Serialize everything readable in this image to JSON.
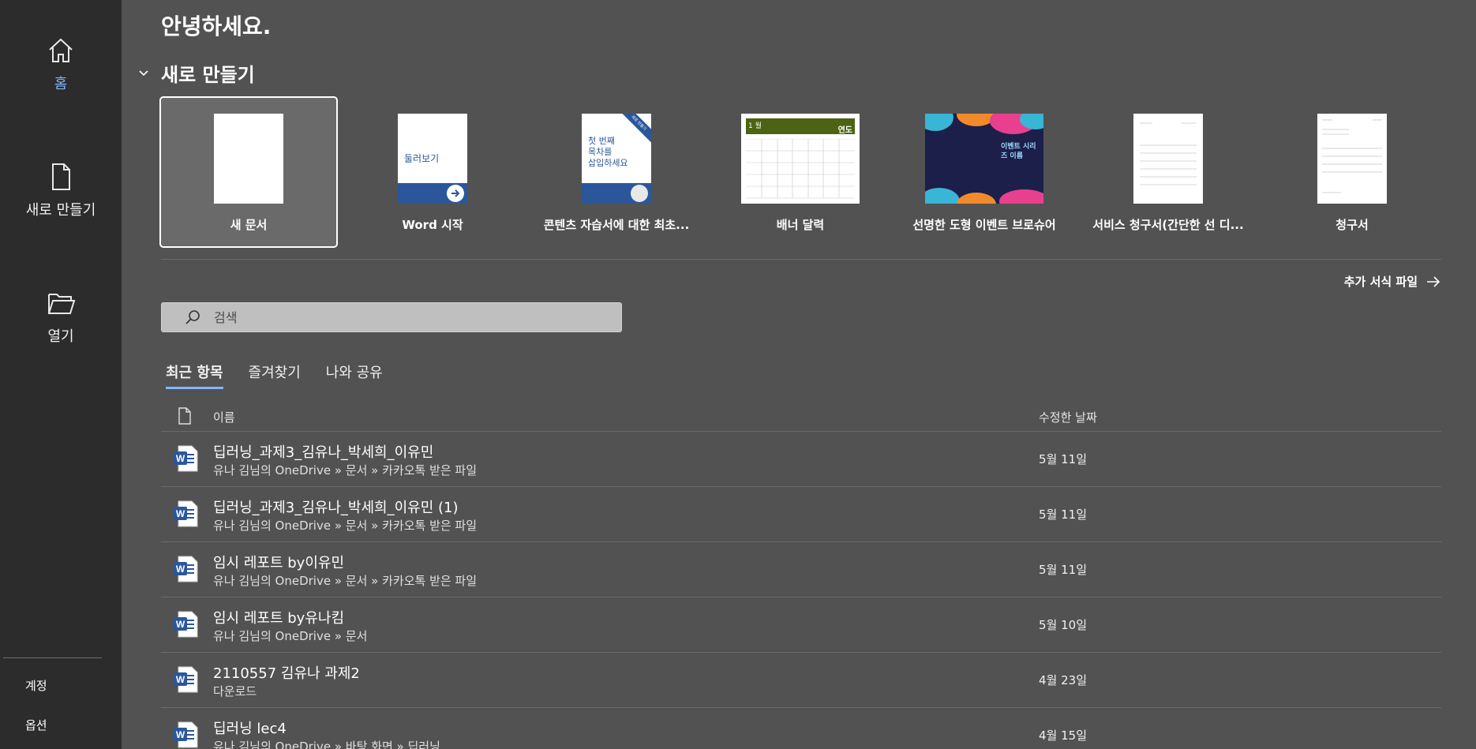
{
  "nav": {
    "home_label": "홈",
    "new_label": "새로 만들기",
    "open_label": "열기",
    "account_label": "계정",
    "options_label": "옵션"
  },
  "main": {
    "greeting": "안녕하세요.",
    "new_section_title": "새로 만들기",
    "templates": [
      {
        "name": "새 문서",
        "icon": "blank-document"
      },
      {
        "name": "Word 시작",
        "icon": "tour-template",
        "thumb_text": "둘러보기"
      },
      {
        "name": "콘텐츠 자습서에 대한 최초...",
        "icon": "toc-template",
        "thumb_text": "첫 번째\n목차를\n삽입하세요",
        "badge": "새로 만들기"
      },
      {
        "name": "배너 달력",
        "icon": "calendar-template",
        "thumb_text_left": "1 월",
        "thumb_text_right": "연도"
      },
      {
        "name": "선명한 도형 이벤트 브로슈어",
        "icon": "brochure-template",
        "thumb_text": "이벤트 시리즈 이름"
      },
      {
        "name": "서비스 청구서(간단한 선 디...",
        "icon": "invoice-template"
      },
      {
        "name": "청구서",
        "icon": "invoice-template-2"
      }
    ],
    "more_templates_label": "추가 서식 파일",
    "search_placeholder": "검색",
    "tabs": [
      "최근 항목",
      "즐겨찾기",
      "나와 공유"
    ],
    "list_headers": {
      "name": "이름",
      "modified": "수정한 날짜"
    },
    "files": [
      {
        "title": "딥러닝_과제3_김유나_박세희_이유민",
        "path": "유나 김님의 OneDrive » 문서 » 카카오톡 받은 파일",
        "date": "5월 11일"
      },
      {
        "title": "딥러닝_과제3_김유나_박세희_이유민 (1)",
        "path": "유나 김님의 OneDrive » 문서 » 카카오톡 받은 파일",
        "date": "5월 11일"
      },
      {
        "title": "임시 레포트 by이유민",
        "path": "유나 김님의 OneDrive » 문서 » 카카오톡 받은 파일",
        "date": "5월 11일"
      },
      {
        "title": "임시 레포트 by유나킴",
        "path": "유나 김님의 OneDrive » 문서",
        "date": "5월 10일"
      },
      {
        "title": "2110557 김유나 과제2",
        "path": "다운로드",
        "date": "4월 23일"
      },
      {
        "title": "딥러닝 lec4",
        "path": "유나 김님의 OneDrive » 바탕 화면 » 딥러닝",
        "date": "4월 15일"
      }
    ]
  },
  "colors": {
    "nav_bg": "#2c2c2c",
    "main_bg": "#525252",
    "accent": "#82b6ff",
    "word_blue": "#2b579a"
  }
}
